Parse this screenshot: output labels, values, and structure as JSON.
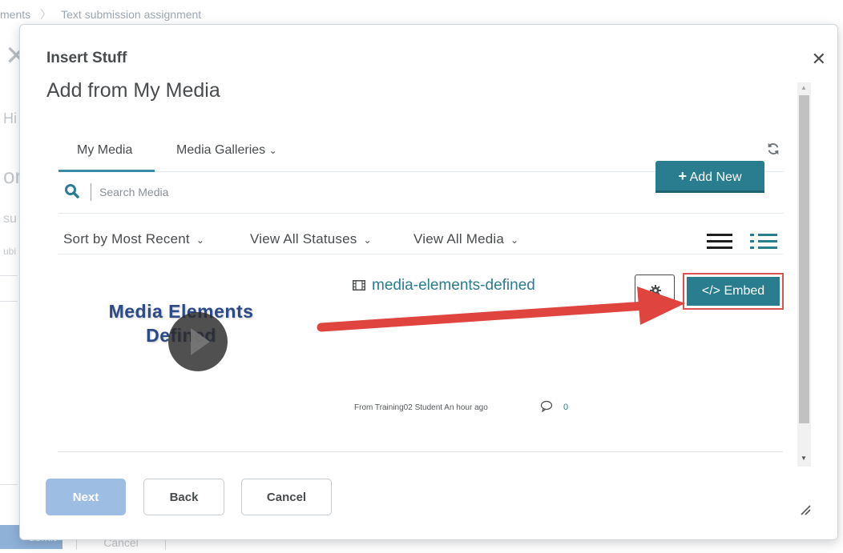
{
  "background": {
    "breadcrumb_prev": "ments",
    "breadcrumb_current": "Text submission assignment",
    "submit_label": "ubmit",
    "cancel_label": "Cancel"
  },
  "dialog": {
    "title": "Insert Stuff",
    "heading": "Add from My Media",
    "close_icon": "close-icon"
  },
  "tabs": {
    "my_media": "My Media",
    "media_galleries": "Media Galleries"
  },
  "search": {
    "placeholder": "Search Media",
    "value": ""
  },
  "add_new_label": "Add New",
  "filters": {
    "sort": "Sort by Most Recent",
    "statuses": "View All Statuses",
    "media": "View All Media"
  },
  "media_item": {
    "thumbnail_line1": "Media Elements",
    "thumbnail_line2": "Defined",
    "title": "media-elements-defined",
    "embed_label": "</> Embed",
    "meta": "From Training02 Student An hour ago",
    "comment_count": "0"
  },
  "footer": {
    "next": "Next",
    "back": "Back",
    "cancel": "Cancel"
  },
  "colors": {
    "accent": "#2a7d8f",
    "highlight_border": "#d9534f",
    "arrow": "#e0443e",
    "next_disabled": "#9dbde2"
  }
}
